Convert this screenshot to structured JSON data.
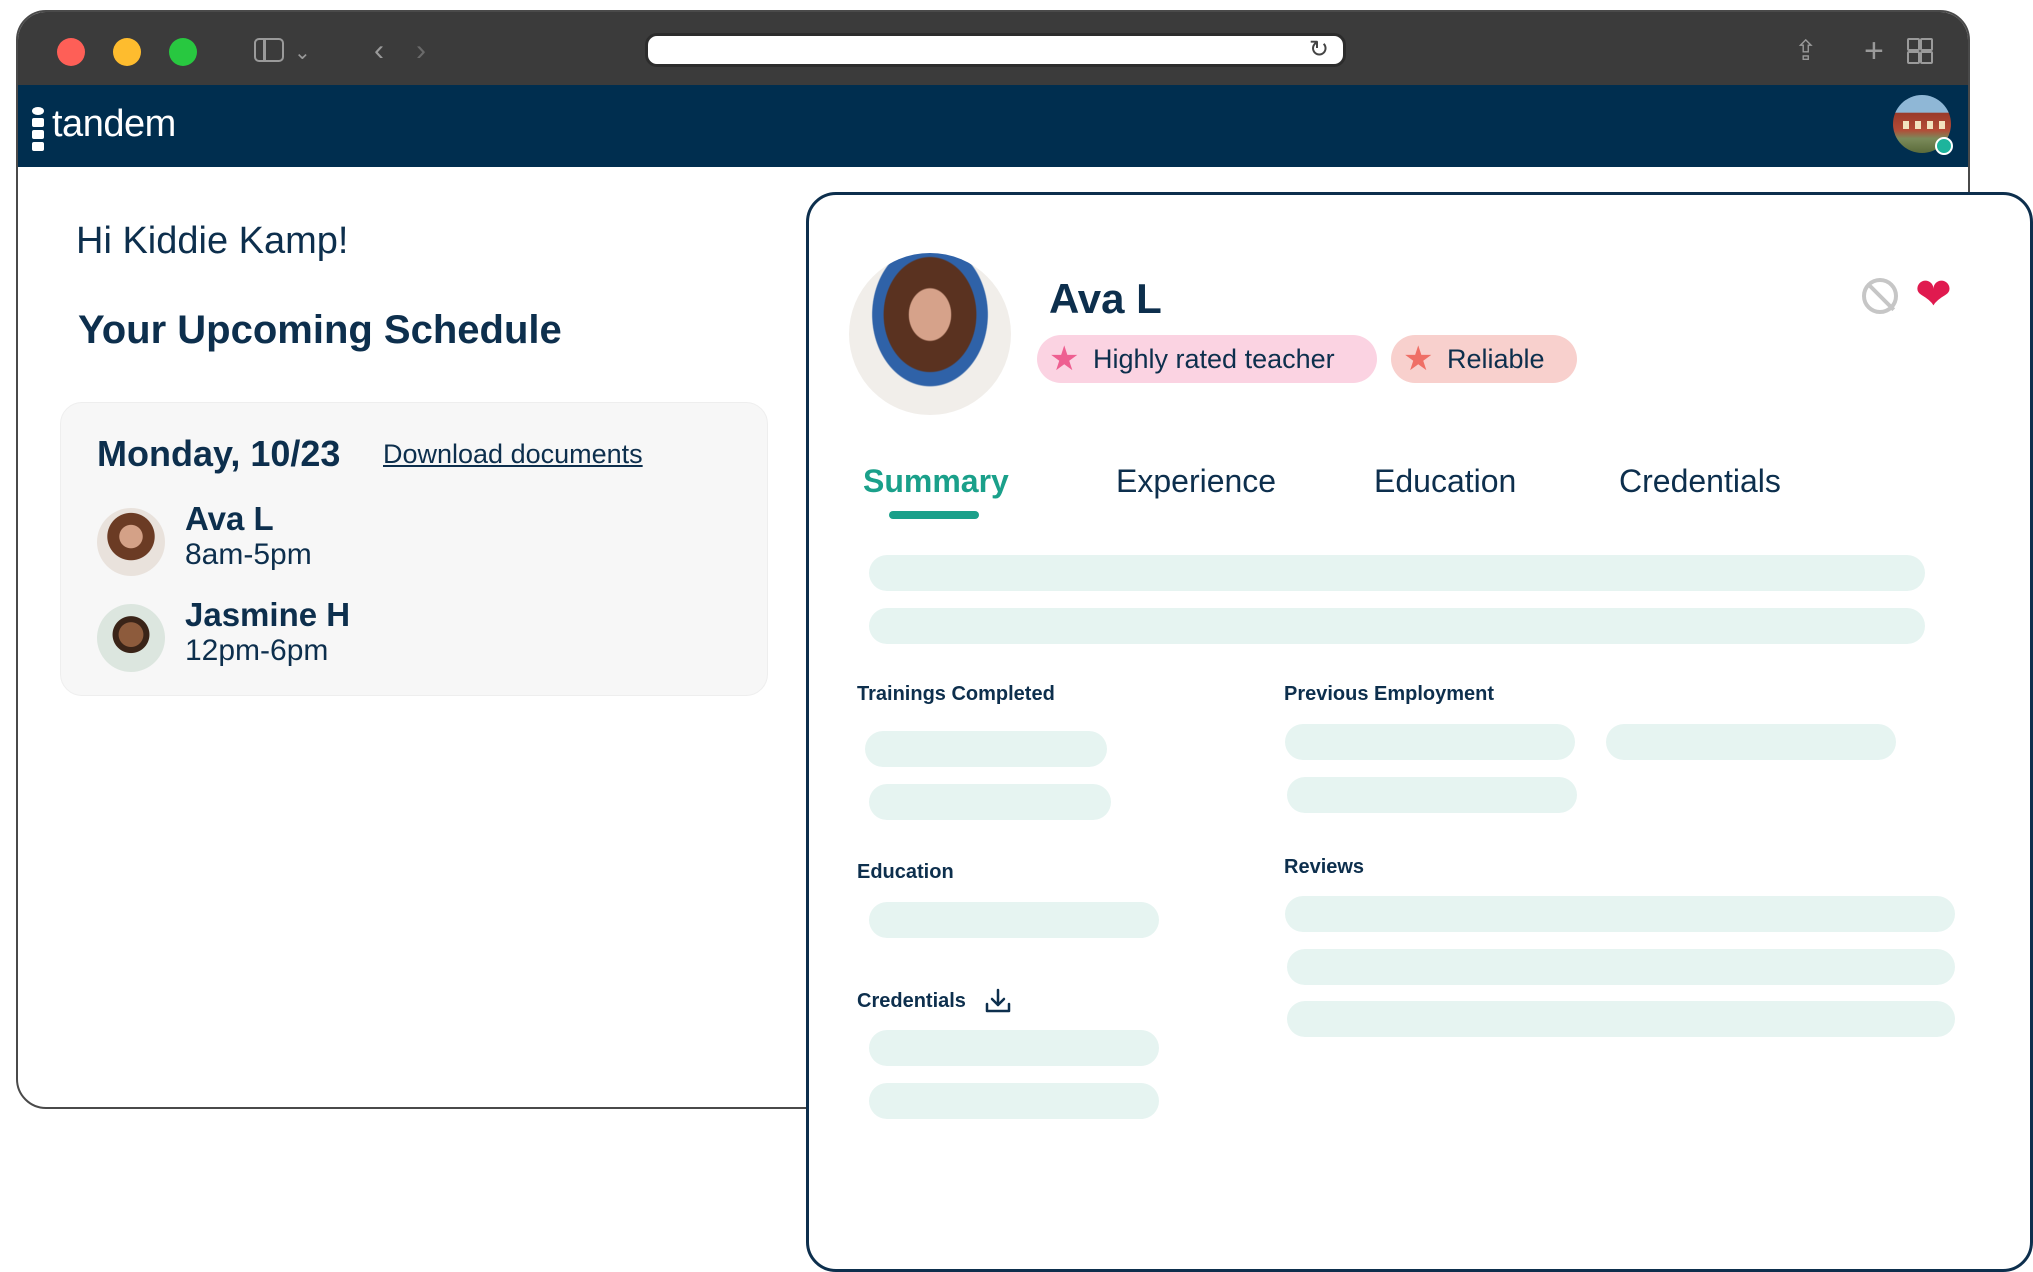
{
  "app": {
    "logo_text": "tandem"
  },
  "left": {
    "greeting": "Hi Kiddie Kamp!",
    "schedule_title": "Your Upcoming Schedule",
    "day": "Monday, 10/23",
    "download_link": "Download documents",
    "shifts": [
      {
        "name": "Ava L",
        "time": "8am-5pm"
      },
      {
        "name": "Jasmine H",
        "time": "12pm-6pm"
      }
    ]
  },
  "profile": {
    "name": "Ava L",
    "badges": [
      "Highly rated teacher",
      "Reliable"
    ],
    "tabs": [
      "Summary",
      "Experience",
      "Education",
      "Credentials"
    ],
    "active_tab": "Summary",
    "sections": {
      "trainings": "Trainings Completed",
      "previous_employment": "Previous Employment",
      "education": "Education",
      "reviews": "Reviews",
      "credentials": "Credentials"
    }
  },
  "colors": {
    "navy": "#002e4f",
    "accent_green": "#1aa08a",
    "heart": "#e01a4f",
    "badge_pink": "#fbd3e2",
    "badge_salmon": "#f8d0cd",
    "skeleton": "#e6f4f1"
  },
  "icons": [
    "close-window",
    "minimize-window",
    "zoom-window",
    "sidebar-toggle-icon",
    "back-icon",
    "forward-icon",
    "reload-icon",
    "share-icon",
    "new-tab-icon",
    "tab-overview-icon",
    "block-icon",
    "heart-icon",
    "star-icon",
    "download-icon"
  ]
}
